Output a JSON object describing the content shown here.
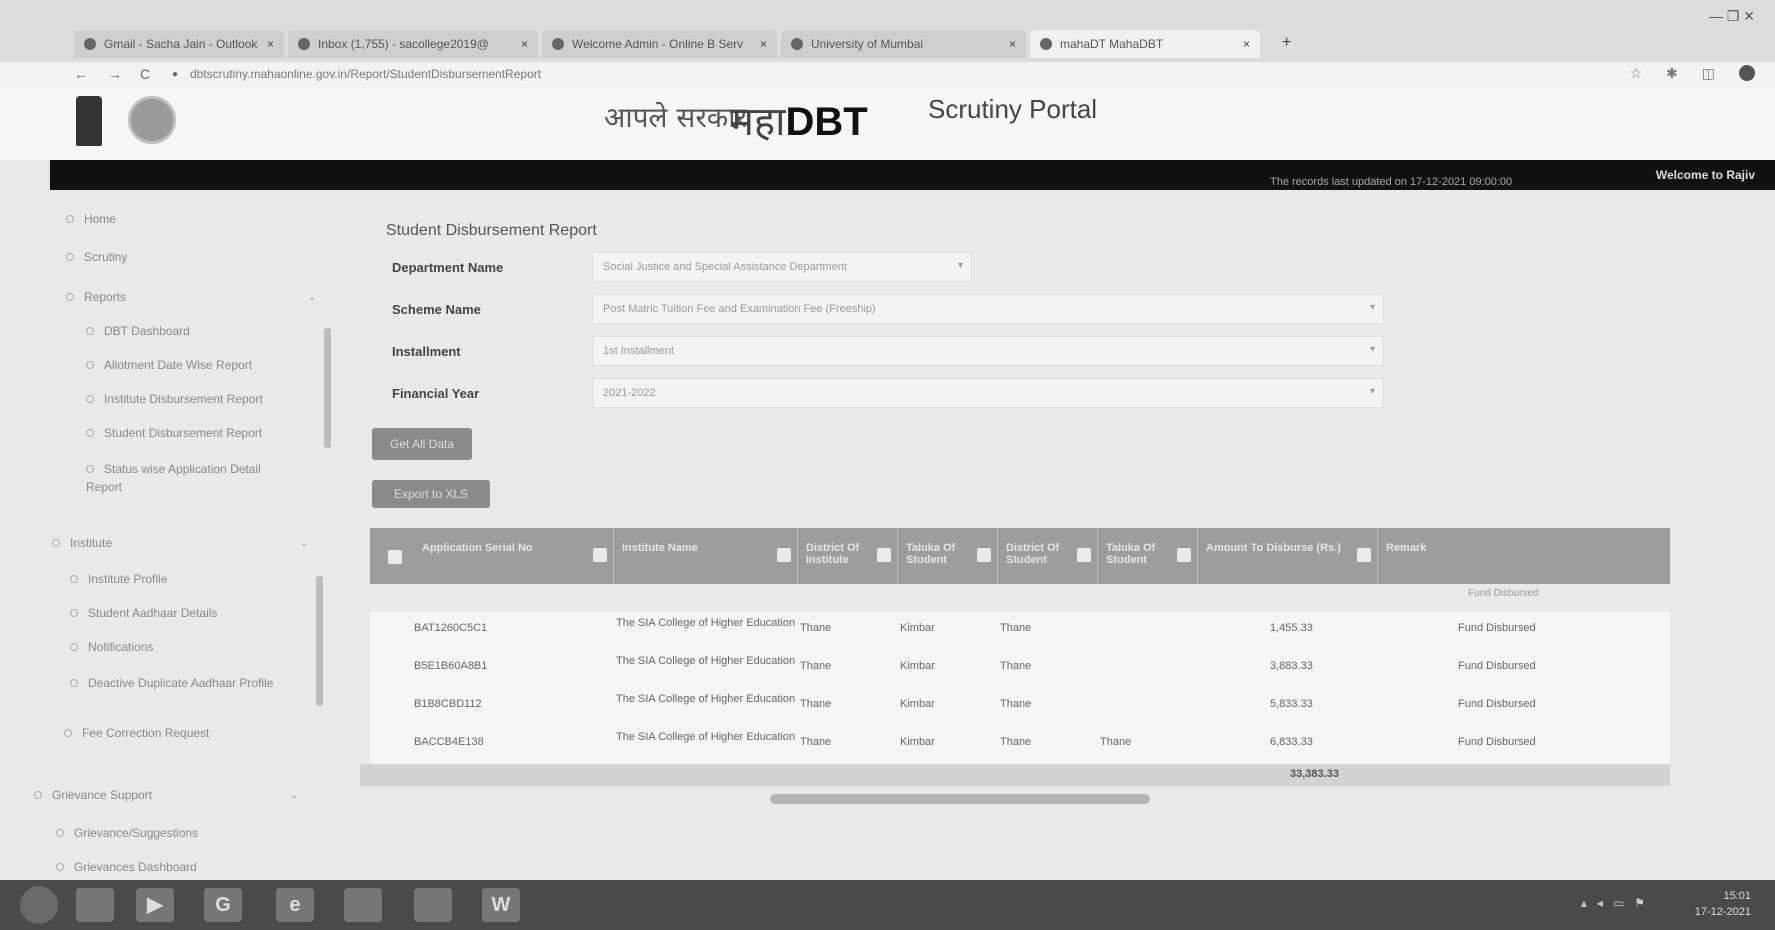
{
  "browser": {
    "tabs": [
      {
        "label": "Gmail - Sacha Jain - Outlook"
      },
      {
        "label": "Inbox (1,755) - sacollege2019@"
      },
      {
        "label": "Welcome Admin - Online B Serv"
      },
      {
        "label": "University of Mumbai"
      },
      {
        "label": "mahaDT MahaDBT"
      }
    ],
    "new_tab": "+",
    "url": "dbtscrutiny.mahaonline.gov.in/Report/StudentDisbursementReport",
    "nav_back": "←",
    "nav_forward": "→",
    "nav_reload": "C",
    "window_controls": "—  ❐  ✕",
    "tools": [
      "☆",
      "✱",
      "◫"
    ]
  },
  "header": {
    "logo_apale": "आपले सरकार",
    "logo_maha": "महा",
    "logo_dbt": "DBT",
    "portal_title": "Scrutiny Portal",
    "welcome": "Welcome to Rajiv",
    "last_updated": "The records last updated on 17-12-2021 09:00:00"
  },
  "sidebar": {
    "home": "Home",
    "scrutiny": "Scrutiny",
    "reports": "Reports",
    "report_items": [
      "DBT Dashboard",
      "Allotment Date Wise Report",
      "Institute Disbursement Report",
      "Student Disbursement Report",
      "Status wise Application Detail Report"
    ],
    "institute": "Institute",
    "institute_items": [
      "Institute Profile",
      "Student Aadhaar Details",
      "Notifications",
      "Deactive Duplicate Aadhaar Profile",
      "Fee Correction Request"
    ],
    "grievance": "Grievance Support",
    "grievance_items": [
      "Grievance/Suggestions",
      "Grievances Dashboard"
    ]
  },
  "form": {
    "title": "Student Disbursement Report",
    "department_label": "Department Name",
    "department_value": "Social Justice and Special Assistance Department",
    "scheme_label": "Scheme Name",
    "scheme_value": "Post Matric Tuition Fee and Examination Fee (Freeship)",
    "installment_label": "Installment",
    "installment_value": "1st Installment",
    "year_label": "Financial Year",
    "year_value": "2021-2022",
    "get_button": "Get All Data",
    "export_button": "Export to XLS"
  },
  "table": {
    "columns": [
      "Application Serial No",
      "Institute Name",
      "District Of Institute",
      "Taluka Of Student",
      "District Of Student",
      "Taluka Of Student",
      "Amount To Disburse (Rs.)",
      "Remark"
    ],
    "subheader": "Fund Disbursed",
    "rows": [
      {
        "id": "BAT1260C5C1",
        "inst": "The SIA College of Higher Education",
        "district": "Thane",
        "taluka": "Kimbar",
        "sdistrict": "Thane",
        "staluka": "",
        "amount": "1,455.33",
        "remark": "Fund Disbursed"
      },
      {
        "id": "B5E1B60A8B1",
        "inst": "The SIA College of Higher Education",
        "district": "Thane",
        "taluka": "Kimbar",
        "sdistrict": "Thane",
        "staluka": "",
        "amount": "3,883.33",
        "remark": "Fund Disbursed"
      },
      {
        "id": "B1B8CBD112",
        "inst": "The SIA College of Higher Education",
        "district": "Thane",
        "taluka": "Kimbar",
        "sdistrict": "Thane",
        "staluka": "",
        "amount": "5,833.33",
        "remark": "Fund Disbursed"
      },
      {
        "id": "BACCB4E138",
        "inst": "The SIA College of Higher Education",
        "district": "Thane",
        "taluka": "Kimbar",
        "sdistrict": "Thane",
        "staluka": "Thane",
        "amount": "6,833.33",
        "remark": "Fund Disbursed"
      }
    ],
    "total": "33,383.33"
  },
  "taskbar": {
    "time": "15:01",
    "date": "17-12-2021",
    "icons": [
      "G",
      "e",
      "W"
    ]
  }
}
